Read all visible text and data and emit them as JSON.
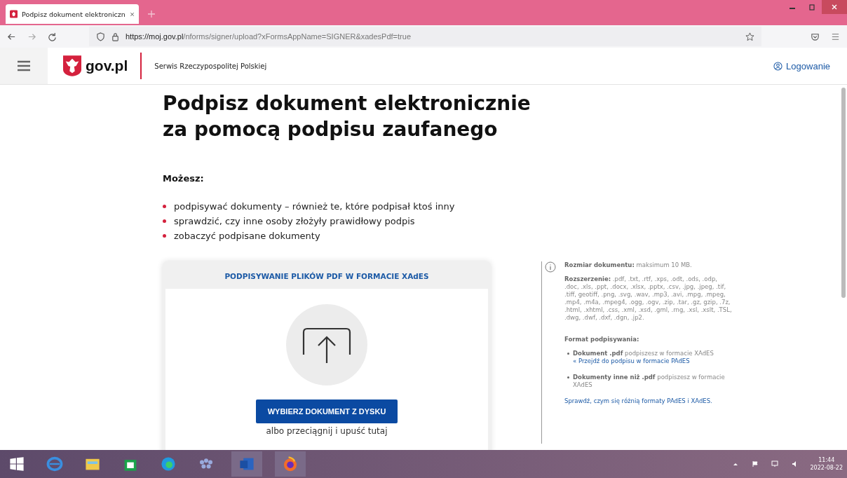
{
  "browser": {
    "tab_title": "Podpisz dokument elektroniczn",
    "url_host": "https://moj.gov.pl",
    "url_path": "/nforms/signer/upload?xFormsAppName=SIGNER&xadesPdf=true"
  },
  "header": {
    "logo": "gov.pl",
    "service": "Serwis Rzeczypospolitej Polskiej",
    "login": "Logowanie"
  },
  "title_lines": [
    "Podpisz dokument elektronicznie",
    "za pomocą podpisu zaufanego"
  ],
  "intro": "Możesz:",
  "bullets": [
    "podpisywać dokumenty – również te, które podpisał ktoś inny",
    "sprawdzić, czy inne osoby złożyły prawidłowy podpis",
    "zobaczyć podpisane dokumenty"
  ],
  "upload_card": {
    "title": "PODPISYWANIE PLIKÓW PDF W FORMACIE XAdES",
    "button": "WYBIERZ DOKUMENT Z DYSKU",
    "drop_hint": "albo przeciągnij i upuść tutaj"
  },
  "info": {
    "size": "**Rozmiar dokumentu:** maksimum 10 MB.",
    "extensions": "**Rozszerzenie:** .pdf, .txt, .rtf, .xps, .odt, .ods, .odp, .doc, .xls, .ppt, .docx, .xlsx, .pptx, .csv, .jpg, .jpeg, .tif, .tiff, geotiff, .png, .svg, .wav, .mp3, .avi, .mpg, .mpeg, .mp4, .m4a, .mpeg4, .ogg, .ogv, .zip, .tar, .gz, gzip, .7z, .html, .xhtml, .css, .xml, .xsd, .gml, .rng, .xsl, .xslt, .TSL, .dwg, .dwf, .dxf, .dgn, .jp2.",
    "format_heading": "Format podpisywania:",
    "formats": [
      {
        "text": "**Dokument .pdf** podpiszesz w formacie XAdES",
        "link": "« Przejdź do podpisu w formacie PAdES"
      },
      {
        "text": "**Dokumenty inne niż .pdf** podpiszesz w formacie XAdES"
      }
    ],
    "compare_link": "Sprawdź, czym się różnią formaty PAdES i XAdES."
  },
  "taskbar": {
    "time": "11:44",
    "date": "2022-08-22"
  }
}
